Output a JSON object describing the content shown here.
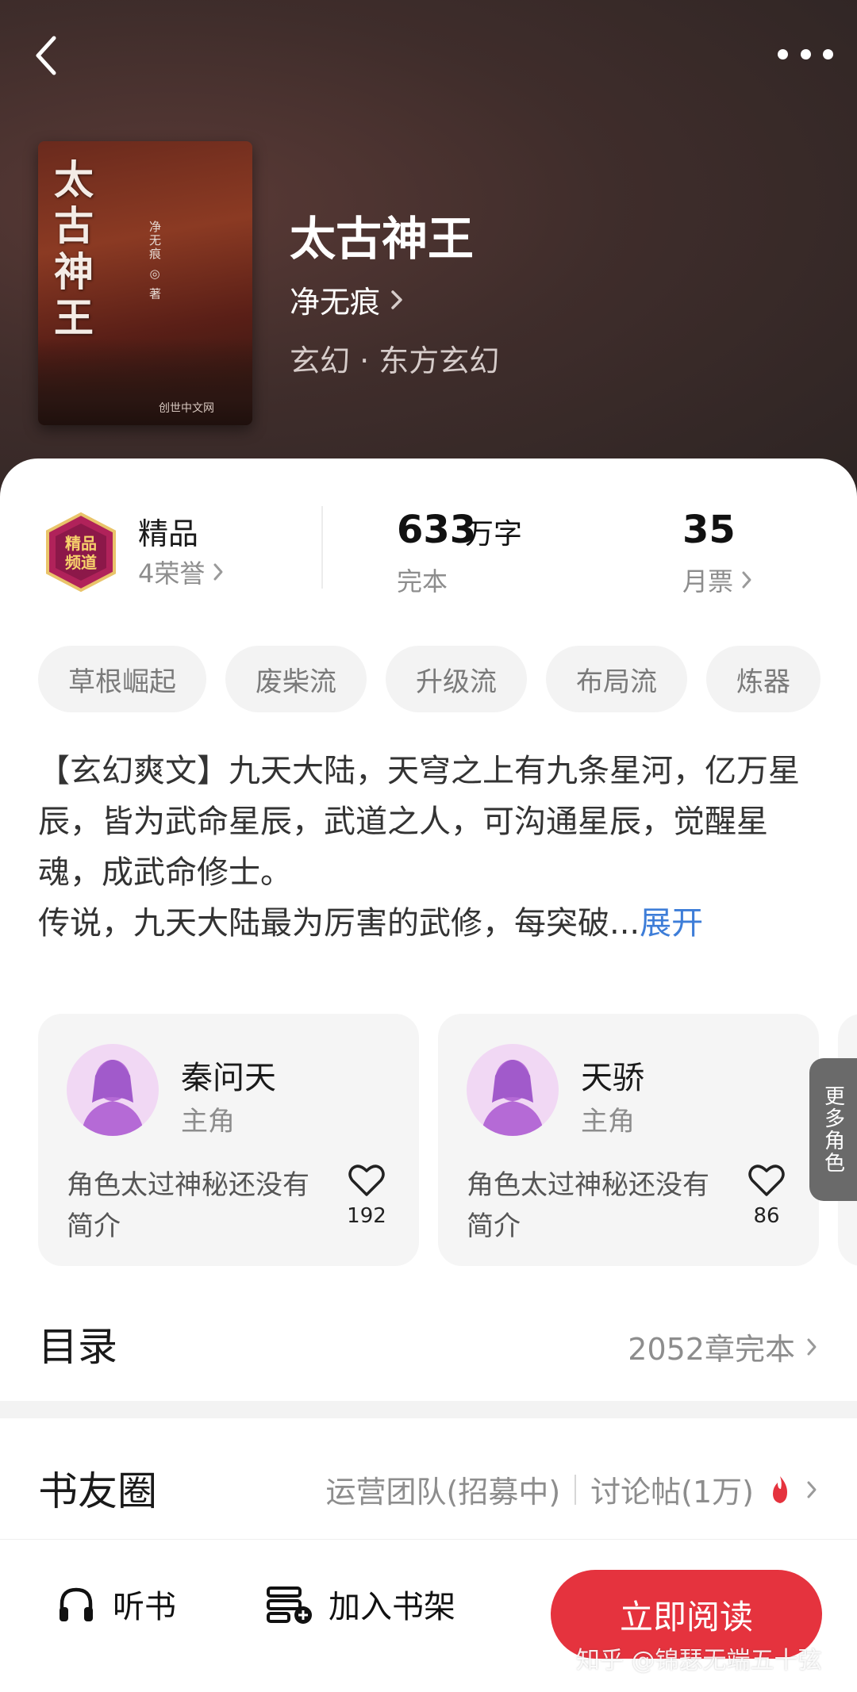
{
  "book": {
    "title": "太古神王",
    "author": "净无痕",
    "genre": "玄幻 · 东方玄幻",
    "cover_title": "太古神王",
    "cover_author": "净无痕 ◎ 著",
    "cover_publisher": "创世中文网"
  },
  "stats": {
    "badge_label": "精品",
    "honors": "4荣誉",
    "word_count": "633",
    "word_unit": "万字",
    "status": "完本",
    "monthly_votes": "35",
    "monthly_label": "月票"
  },
  "tags": [
    "草根崛起",
    "废柴流",
    "升级流",
    "布局流",
    "炼器"
  ],
  "description": {
    "text": "【玄幻爽文】九天大陆，天穹之上有九条星河，亿万星辰，皆为武命星辰，武道之人，可沟通星辰，觉醒星魂，成武命修士。\n传说，九天大陆最为厉害的武修，每突破...",
    "expand": "展开"
  },
  "characters": [
    {
      "name": "秦问天",
      "role": "主角",
      "desc": "角色太过神秘还没有简介",
      "likes": "192"
    },
    {
      "name": "天骄",
      "role": "主角",
      "desc": "角色太过神秘还没有简介",
      "likes": "86"
    }
  ],
  "more_roles": "更多角色",
  "toc": {
    "title": "目录",
    "summary": "2052章完本"
  },
  "circle": {
    "title": "书友圈",
    "team": "运营团队(招募中)",
    "posts": "讨论帖(1万)"
  },
  "actions": {
    "listen": "听书",
    "add_shelf": "加入书架",
    "read_now": "立即阅读"
  },
  "watermark": "知乎 @锦瑟无端五十弦",
  "colors": {
    "accent": "#e5333e",
    "link": "#3d7dd8"
  }
}
